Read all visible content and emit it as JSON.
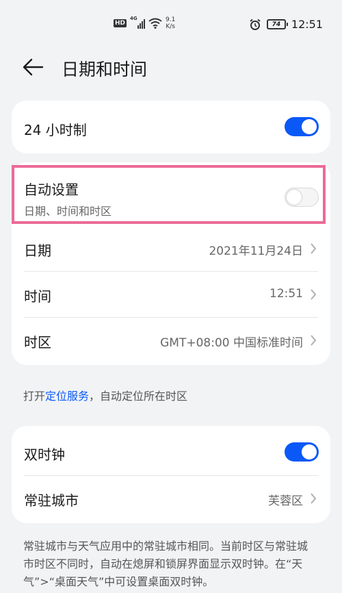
{
  "status_bar": {
    "hd": "HD",
    "network": "4G",
    "speed_value": "9.1",
    "speed_unit": "K/s",
    "battery": "74",
    "time": "12:51",
    "icons": [
      "hd-icon",
      "signal-icon",
      "wifi-icon",
      "alarm-icon",
      "battery-icon"
    ]
  },
  "header": {
    "title": "日期和时间",
    "back_icon": "arrow-left-icon"
  },
  "card_format": {
    "label": "24 小时制",
    "toggle_on": true
  },
  "card_main": {
    "auto": {
      "label": "自动设置",
      "sublabel": "日期、时间和时区",
      "toggle_on": false
    },
    "date": {
      "label": "日期",
      "value": "2021年11月24日"
    },
    "time": {
      "label": "时间",
      "value": "12:51"
    },
    "timezone": {
      "label": "时区",
      "value": "GMT+08:00 中国标准时间"
    }
  },
  "location_note": {
    "prefix": "打开",
    "link": "定位服务",
    "suffix": "，自动定位所在时区"
  },
  "card_dual": {
    "dual_clock": {
      "label": "双时钟",
      "toggle_on": true
    },
    "home_city": {
      "label": "常驻城市",
      "value": "芙蓉区"
    }
  },
  "dual_description": "常驻城市与天气应用中的常驻城市相同。当前时区与常驻城市时区不同时，自动在熄屏和锁屏界面显示双时钟。在“天气”>“桌面天气”中可设置桌面双时钟。",
  "colors": {
    "accent": "#0a59f7",
    "highlight": "#eb6b96",
    "background": "#f1f3f5",
    "card": "#ffffff"
  }
}
